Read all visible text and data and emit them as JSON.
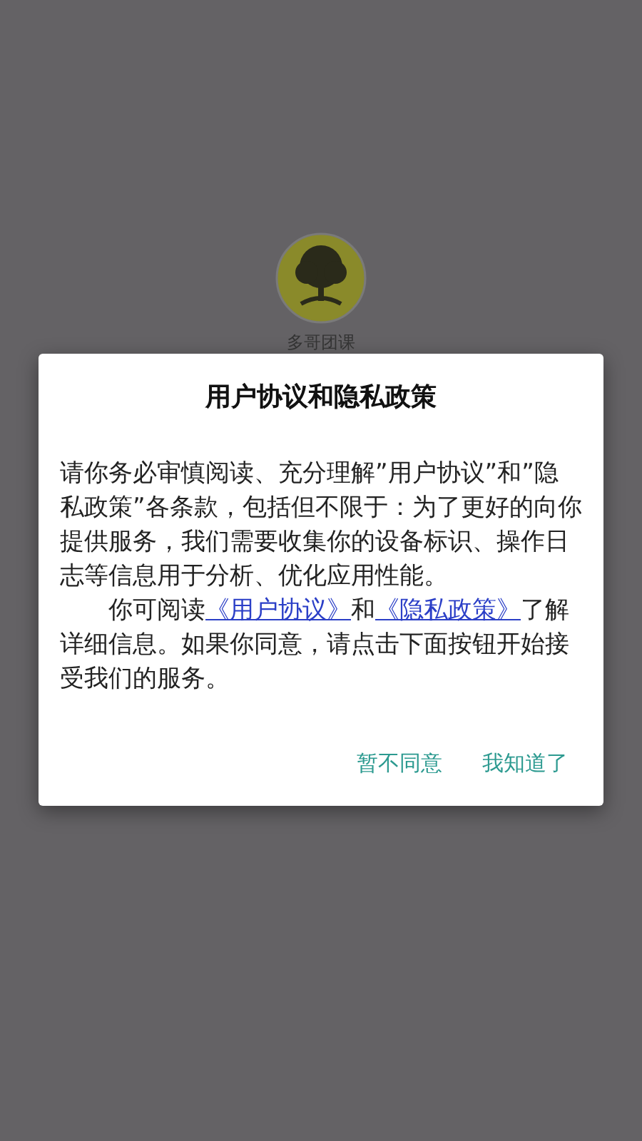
{
  "app": {
    "name": "多哥团课"
  },
  "dialog": {
    "title": "用户协议和隐私政策",
    "paragraph_1": "请你务必审慎阅读、充分理解”用户协议”和”隐私政策”各条款，包括但不限于：为了更好的向你提供服务，我们需要收集你的设备标识、操作日志等信息用于分析、优化应用性能。",
    "paragraph_2": [
      {
        "kind": "text",
        "text": "你可阅读"
      },
      {
        "kind": "link",
        "text": "《用户协议》"
      },
      {
        "kind": "text",
        "text": "和"
      },
      {
        "kind": "link",
        "text": "《隐私政策》"
      },
      {
        "kind": "text",
        "text": "了解详细信息。如果你同意，请点击下面按钮开始接受我们的服务。"
      }
    ],
    "buttons": [
      "暂不同意",
      "我知道了"
    ]
  }
}
